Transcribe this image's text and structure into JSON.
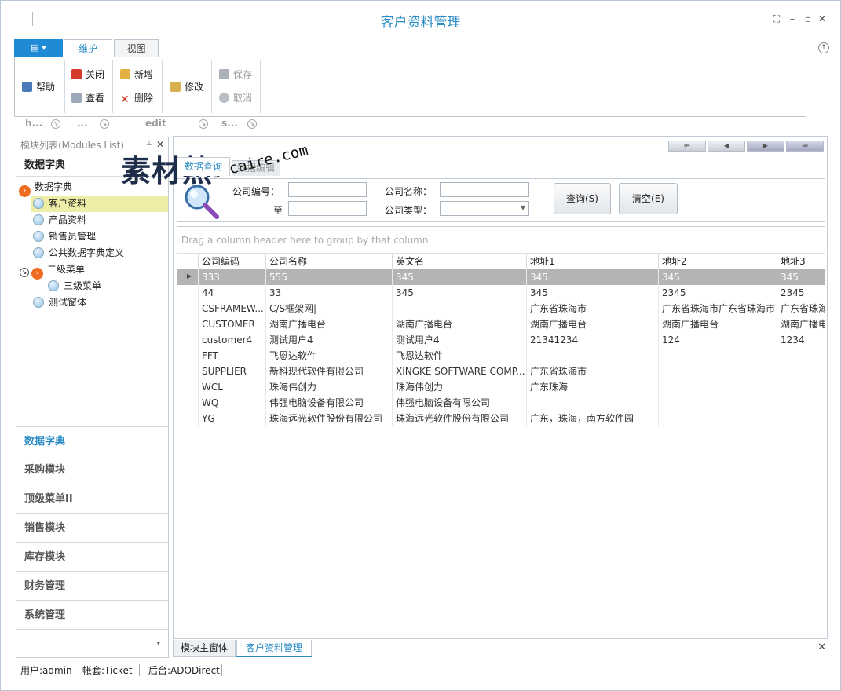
{
  "window": {
    "title": "客户资料管理"
  },
  "ribbon": {
    "tabs": [
      {
        "label": "维护"
      },
      {
        "label": "视图"
      }
    ],
    "buttons": {
      "help": "帮助",
      "close": "关闭",
      "view": "查看",
      "add": "新增",
      "delete": "删除",
      "edit": "修改",
      "save": "保存",
      "cancel": "取消"
    },
    "group_labels": [
      "h...",
      "...",
      "edit",
      "s..."
    ]
  },
  "left_panel": {
    "header": "模块列表(Modules List)",
    "section_title": "数据字典",
    "tree": [
      {
        "label": "数据字典",
        "level": 0,
        "kind": "orange"
      },
      {
        "label": "客户资料",
        "level": 1,
        "kind": "blue",
        "selected": true
      },
      {
        "label": "产品资料",
        "level": 1,
        "kind": "blue"
      },
      {
        "label": "销售员管理",
        "level": 1,
        "kind": "blue"
      },
      {
        "label": "公共数据字典定义",
        "level": 1,
        "kind": "blue"
      },
      {
        "label": "二级菜单",
        "level": 0,
        "kind": "orange"
      },
      {
        "label": "三级菜单",
        "level": 2,
        "kind": "blue"
      },
      {
        "label": "测试窗体",
        "level": 1,
        "kind": "blue"
      }
    ],
    "nav": [
      {
        "label": "数据字典",
        "active": true
      },
      {
        "label": "采购模块"
      },
      {
        "label": "顶级菜单II"
      },
      {
        "label": "销售模块"
      },
      {
        "label": "库存模块"
      },
      {
        "label": "财务管理"
      },
      {
        "label": "系统管理"
      }
    ]
  },
  "main": {
    "tabs": [
      {
        "label": "数据查询"
      },
      {
        "label": "数据编辑"
      }
    ],
    "query": {
      "company_code_label": "公司编号：",
      "to_label": "至",
      "company_name_label": "公司名称：",
      "company_type_label": "公司类型：",
      "query_button": "查询(S)",
      "clear_button": "清空(E)"
    },
    "grid": {
      "group_hint": "Drag a column header here to group by that column",
      "columns": [
        "公司编码",
        "公司名称",
        "英文名",
        "地址1",
        "地址2",
        "地址3"
      ],
      "rows": [
        [
          "333",
          "555",
          "345",
          "345",
          "345",
          "345"
        ],
        [
          "44",
          "33",
          "345",
          "345",
          "2345",
          "2345"
        ],
        [
          "CSFRAMEW...",
          "C/S框架网|",
          "",
          "广东省珠海市",
          "广东省珠海市广东省珠海市",
          "广东省珠海"
        ],
        [
          "CUSTOMER",
          "湖南广播电台",
          "湖南广播电台",
          "湖南广播电台",
          "湖南广播电台",
          "湖南广播电"
        ],
        [
          "customer4",
          "测试用户4",
          "测试用户4",
          "21341234",
          "124",
          "1234"
        ],
        [
          "FFT",
          "飞恩达软件",
          "飞恩达软件",
          "",
          "",
          ""
        ],
        [
          "SUPPLIER",
          "新科现代软件有限公司",
          "XINGKE SOFTWARE COMP...",
          "广东省珠海市",
          "",
          ""
        ],
        [
          "WCL",
          "珠海伟创力",
          "珠海伟创力",
          "广东珠海",
          "",
          ""
        ],
        [
          "WQ",
          "伟强电脑设备有限公司",
          "伟强电脑设备有限公司",
          "",
          "",
          ""
        ],
        [
          "YG",
          "珠海远光软件股份有限公司",
          "珠海远光软件股份有限公司",
          "广东，珠海，南方软件园",
          "",
          ""
        ]
      ]
    }
  },
  "doc_tabs": [
    {
      "label": "模块主窗体"
    },
    {
      "label": "客户资料管理",
      "active": true
    }
  ],
  "status": {
    "user": "用户:admin",
    "account": "帐套:Ticket",
    "backend": "后台:ADODirect"
  },
  "watermark": {
    "main": "素材熱",
    "sub": "sucaire.com"
  },
  "colors": {
    "accent": "#2a8bc4",
    "app_button": "#1f8ad6",
    "selected_tree": "#eeeea6",
    "selected_row": "#b4b4b4",
    "node_orange": "#ef6b1f"
  }
}
